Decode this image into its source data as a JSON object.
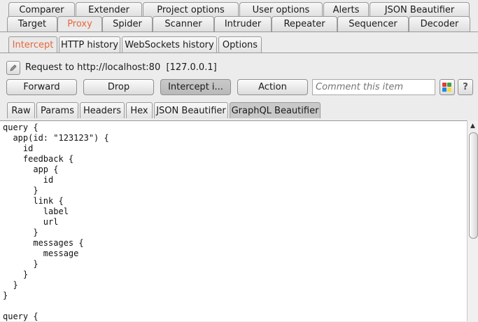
{
  "main_tabs_row1": [
    {
      "label": "Comparer"
    },
    {
      "label": "Extender"
    },
    {
      "label": "Project options"
    },
    {
      "label": "User options"
    },
    {
      "label": "Alerts"
    },
    {
      "label": "JSON Beautifier"
    }
  ],
  "main_tabs_row2": [
    {
      "label": "Target"
    },
    {
      "label": "Proxy"
    },
    {
      "label": "Spider"
    },
    {
      "label": "Scanner"
    },
    {
      "label": "Intruder"
    },
    {
      "label": "Repeater"
    },
    {
      "label": "Sequencer"
    },
    {
      "label": "Decoder"
    }
  ],
  "proxy_tabs": [
    {
      "label": "Intercept"
    },
    {
      "label": "HTTP history"
    },
    {
      "label": "WebSockets history"
    },
    {
      "label": "Options"
    }
  ],
  "request_info": {
    "label": "Request to http://localhost:80",
    "ip": "[127.0.0.1]"
  },
  "actions": {
    "forward": "Forward",
    "drop": "Drop",
    "intercept": "Intercept i...",
    "action": "Action",
    "comment_placeholder": "Comment this item",
    "help": "?"
  },
  "message_tabs": [
    {
      "label": "Raw"
    },
    {
      "label": "Params"
    },
    {
      "label": "Headers"
    },
    {
      "label": "Hex"
    },
    {
      "label": "JSON Beautifier"
    },
    {
      "label": "GraphQL Beautifier"
    }
  ],
  "editor": {
    "text": "query {\n  app(id: \"123123\") {\n    id\n    feedback {\n      app {\n        id\n      }\n      link {\n        label\n        url\n      }\n      messages {\n        message\n      }\n    }\n  }\n}\n\nquery {"
  },
  "colors": {
    "accent_active_tab": "#e8663d",
    "highlight_colors": [
      "#e53935",
      "#43a047",
      "#1e88e5",
      "#fdd835"
    ]
  }
}
